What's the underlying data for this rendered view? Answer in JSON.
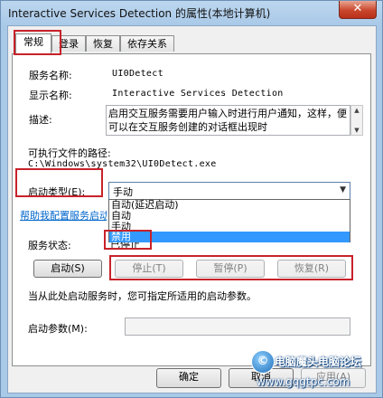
{
  "window": {
    "title": "Interactive Services Detection 的属性(本地计算机)",
    "close_label": "✕"
  },
  "tabs": [
    {
      "label": "常规"
    },
    {
      "label": "登录"
    },
    {
      "label": "恢复"
    },
    {
      "label": "依存关系"
    }
  ],
  "general": {
    "service_name_label": "服务名称:",
    "service_name_value": "UI0Detect",
    "display_name_label": "显示名称:",
    "display_name_value": "Interactive Services Detection",
    "description_label": "描述:",
    "description_value": "启用交互服务需要用户输入时进行用户通知，这样，便可以在交互服务创建的对话框出现时",
    "exe_path_label": "可执行文件的路径:",
    "exe_path_value": "C:\\Windows\\system32\\UI0Detect.exe",
    "startup_type_label": "启动类型(E):",
    "startup_type_value": "手动",
    "startup_options": [
      "自动(延迟启动)",
      "自动",
      "手动",
      "禁用"
    ],
    "startup_selected_option": "禁用",
    "help_link": "帮助我配置服务启动",
    "service_status_label": "服务状态:",
    "service_status_value": "已停止",
    "buttons": {
      "start": "启动(S)",
      "stop": "停止(T)",
      "pause": "暂停(P)",
      "resume": "恢复(R)"
    },
    "hint_text": "当从此处启动服务时，您可指定所适用的启动参数。",
    "start_params_label": "启动参数(M):",
    "start_params_value": ""
  },
  "footer": {
    "ok": "确定",
    "cancel": "取消",
    "apply": "应用(A)"
  },
  "watermark": {
    "line1": "电脑魔头电脑论坛",
    "line2": "www.gqgtpc.com"
  }
}
